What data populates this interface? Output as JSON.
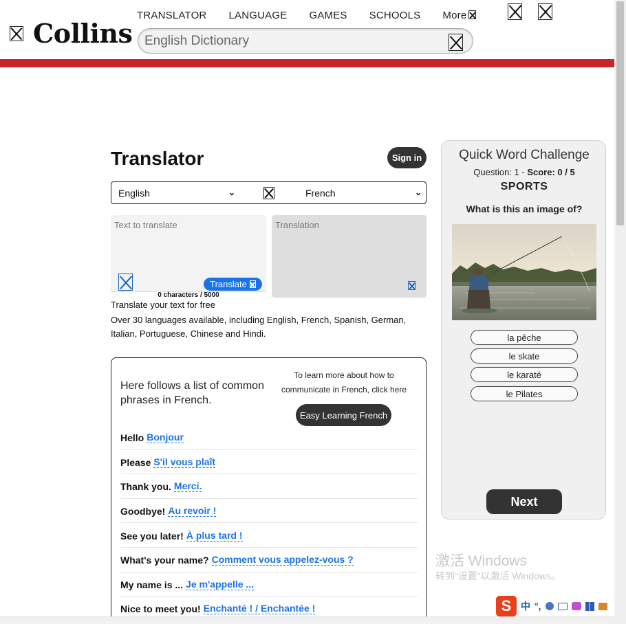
{
  "header": {
    "logo_text": "Collins",
    "nav": [
      "TRANSLATOR",
      "LANGUAGE",
      "GAMES",
      "SCHOOLS",
      "More"
    ],
    "search_placeholder": "English Dictionary"
  },
  "translator": {
    "title": "Translator",
    "sign_in": "Sign in",
    "source_language": "English",
    "target_language": "French",
    "source_placeholder": "Text to translate",
    "target_placeholder": "Translation",
    "translate_button": "Translate",
    "char_count": "0 characters / 5000",
    "free_text": "Translate your text for free",
    "languages_text": "Over 30 languages available, including English, French, Spanish, German, Italian, Portuguese, Chinese and Hindi."
  },
  "phrases": {
    "intro": "Here follows a list of common phrases in French.",
    "learn_text": "To learn more about how to communicate in French, click here",
    "learn_button": "Easy Learning French",
    "items": [
      {
        "en": "Hello",
        "fr": "Bonjour"
      },
      {
        "en": "Please",
        "fr": "S'il vous plaît"
      },
      {
        "en": "Thank you.",
        "fr": "Merci."
      },
      {
        "en": "Goodbye!",
        "fr": "Au revoir !"
      },
      {
        "en": "See you later!",
        "fr": "À plus tard !"
      },
      {
        "en": "What's your name?",
        "fr": "Comment vous appelez-vous ?"
      },
      {
        "en": "My name is ...",
        "fr": "Je m'appelle ..."
      },
      {
        "en": "Nice to meet you!",
        "fr": "Enchanté ! / Enchantée !"
      }
    ]
  },
  "quiz": {
    "title": "Quick Word Challenge",
    "question_label": "Question: 1",
    "separator": " - ",
    "score_label": "Score: 0 / 5",
    "category": "SPORTS",
    "prompt": "What is this an image of?",
    "options": [
      "la pêche",
      "le skate",
      "le karaté",
      "le Pilates"
    ],
    "next_button": "Next"
  },
  "watermark": {
    "line1": "激活 Windows",
    "line2": "转到“设置”以激活 Windows。"
  },
  "tray": {
    "ime_logo": "S",
    "ime_lang": "中",
    "ime_punct": "°,"
  },
  "colors": {
    "brand_red": "#c8242b",
    "link_blue": "#1a73e8",
    "dark_button": "#333333"
  }
}
